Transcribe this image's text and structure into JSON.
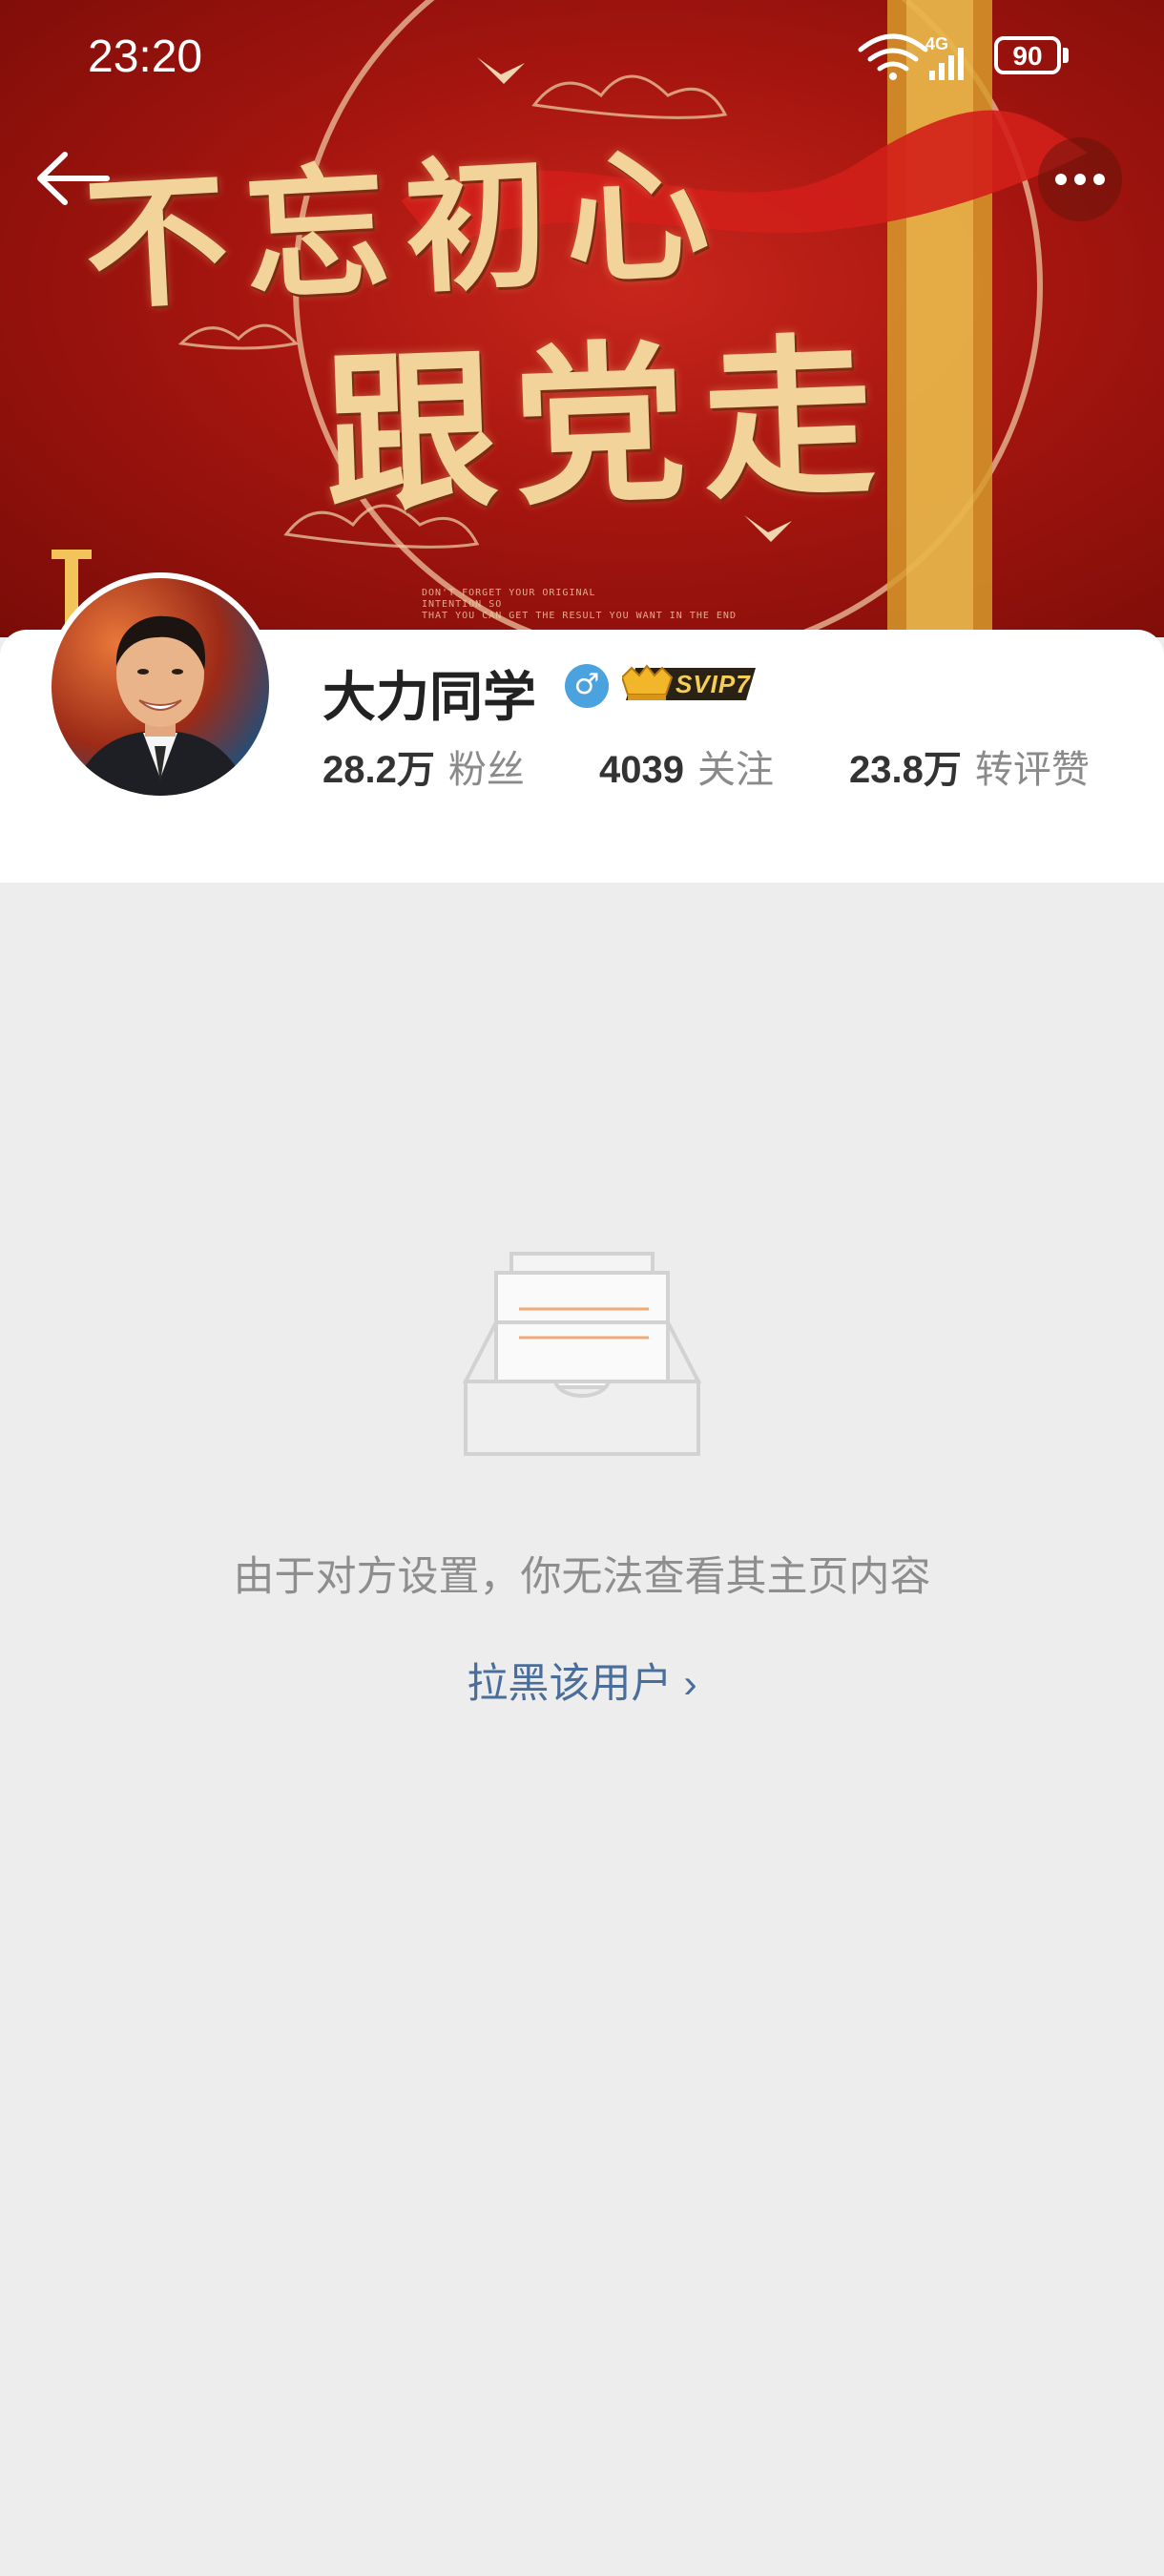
{
  "status_bar": {
    "time": "23:20",
    "network": "4G",
    "battery": "90",
    "icons": [
      "wifi-icon",
      "signal-4g-icon",
      "battery-icon"
    ]
  },
  "header": {
    "back_icon": "arrow-left-icon",
    "more_icon": "more-horizontal-icon"
  },
  "banner": {
    "line1": "不忘初心",
    "line2": "跟党走",
    "caption": "DON'T FORGET YOUR ORIGINAL\nINTENTION SO\nTHAT YOU CAN GET THE RESULT YOU WANT IN THE END"
  },
  "profile": {
    "name": "大力同学",
    "gender_icon": "male-icon",
    "gender_symbol": "♂",
    "vip_badge": "SVIP7",
    "stats": [
      {
        "value": "28.2万",
        "label": "粉丝"
      },
      {
        "value": "4039",
        "label": "关注"
      },
      {
        "value": "23.8万",
        "label": "转评赞"
      }
    ]
  },
  "empty_state": {
    "icon": "empty-inbox-icon",
    "message": "由于对方设置，你无法查看其主页内容",
    "action_label": "拉黑该用户",
    "action_chevron": "›"
  },
  "colors": {
    "banner_red": "#a5150f",
    "link_blue": "#4a6e9c",
    "gender_blue": "#4aa3df",
    "badge_gold": "#f6cd55",
    "page_bg": "#ededed"
  }
}
